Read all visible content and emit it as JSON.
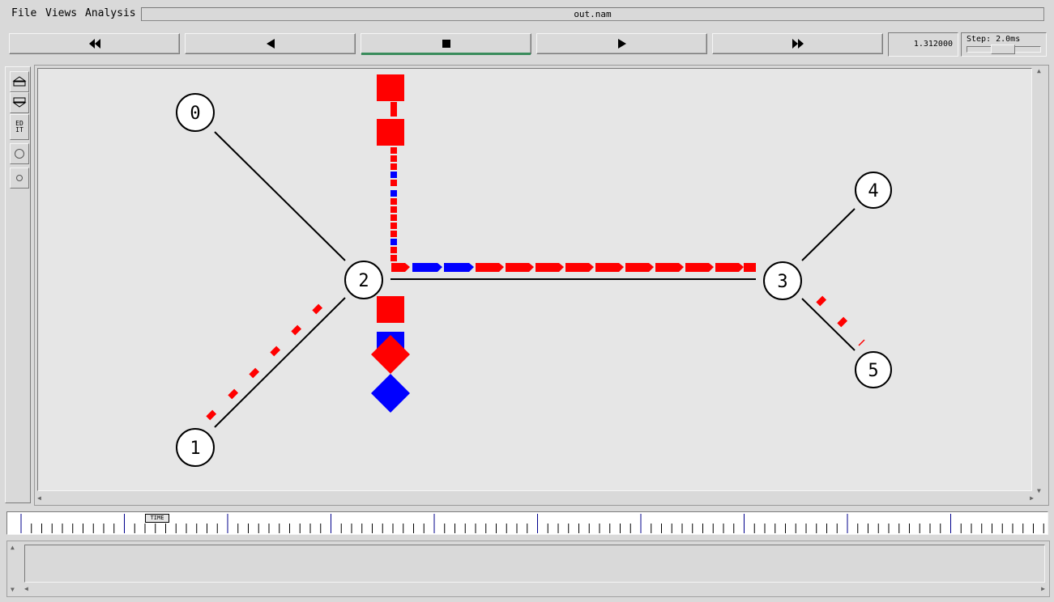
{
  "menu": {
    "file": "File",
    "views": "Views",
    "analysis": "Analysis"
  },
  "file_name": "out.nam",
  "transport": {
    "buttons": [
      "rewind",
      "play-backward",
      "stop",
      "play-forward",
      "fast-forward"
    ],
    "active": "stop"
  },
  "time_display": "1.312000",
  "step": {
    "label": "Step: 2.0ms",
    "slider_fraction": 0.45
  },
  "tools": [
    "zoom-in-icon",
    "zoom-out-icon",
    "edit-icon",
    "large-circle-icon",
    "small-circle-icon"
  ],
  "tool_edit_label": "ED\nIT",
  "timeline_label": "TIME",
  "nodes": [
    "0",
    "1",
    "2",
    "3",
    "4",
    "5"
  ],
  "colors": {
    "flow_a": "#ff0000",
    "flow_b": "#0000ff",
    "link": "#000000",
    "canvas": "#e6e6e6",
    "active_button": "#3a8c5c"
  }
}
